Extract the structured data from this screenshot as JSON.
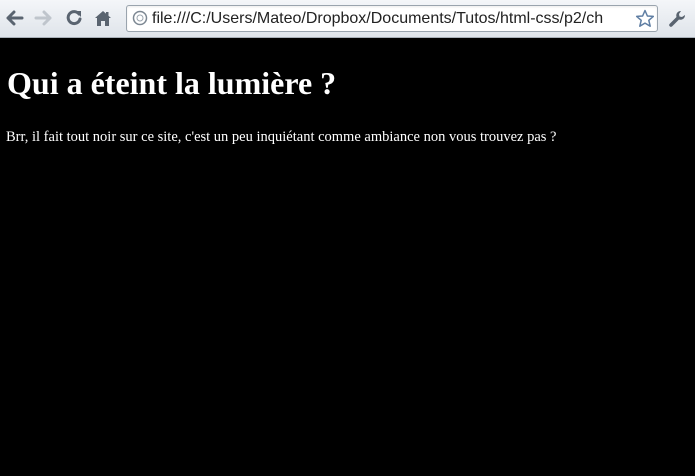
{
  "browser": {
    "url": "file:///C:/Users/Mateo/Dropbox/Documents/Tutos/html-css/p2/ch",
    "icons": [
      "back-arrow-icon",
      "forward-arrow-icon",
      "reload-icon",
      "home-icon",
      "page-icon",
      "star-icon",
      "wrench-icon"
    ]
  },
  "page": {
    "heading": "Qui a éteint la lumière ?",
    "paragraph": "Brr, il fait tout noir sur ce site, c'est un peu inquiétant comme ambiance non vous trouvez pas ?",
    "background_color": "#000000",
    "text_color": "#ffffff"
  }
}
